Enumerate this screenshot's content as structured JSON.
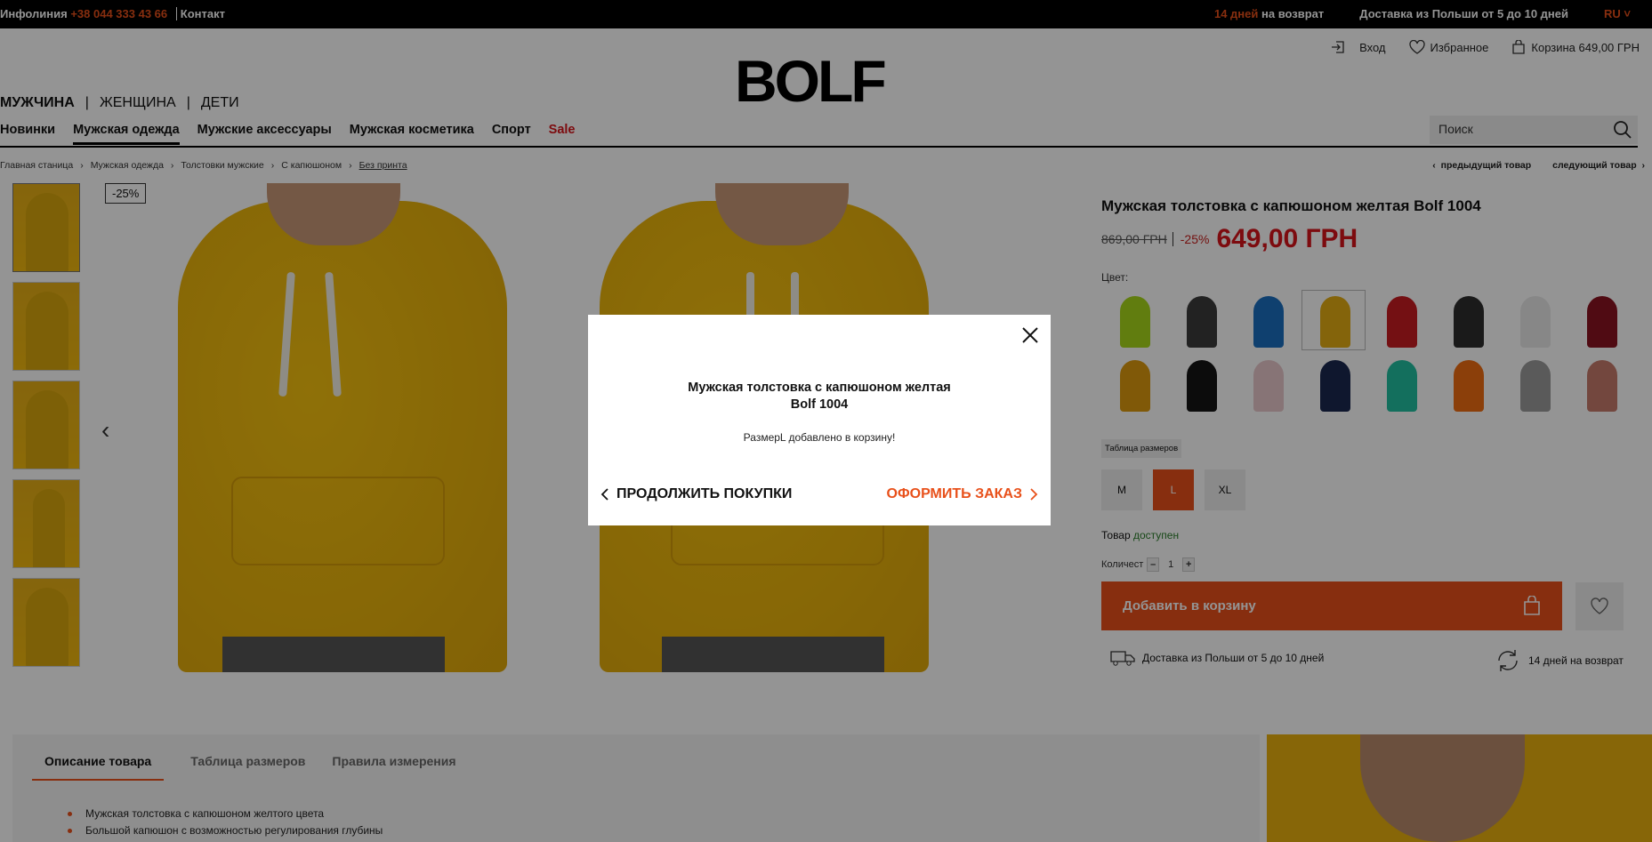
{
  "topbar": {
    "infoline_label": "Инфолиния",
    "phone": "+38 044 333 43 66",
    "contact": "Контакт",
    "return_days": "14 дней",
    "return_text": " на возврат",
    "delivery": "Доставка из Польши от 5 до 10 дней",
    "lang": "RU"
  },
  "header": {
    "login": "Вход",
    "favorites": "Избранное",
    "cart": "Корзина 649,00 ГРН",
    "logo_text": "BOLF"
  },
  "gender_nav": [
    "МУЖЧИНА",
    "|",
    "ЖЕНЩИНА",
    "|",
    "ДЕТИ"
  ],
  "main_nav": [
    "Новинки",
    "Мужская одежда",
    "Мужские аксессуары",
    "Мужская косметика",
    "Спорт",
    "Sale"
  ],
  "search": {
    "placeholder": "Поиск"
  },
  "breadcrumbs": [
    "Главная станица",
    "Мужская одежда",
    "Толстовки мужские",
    "С капюшоном",
    "Без принта"
  ],
  "pager": {
    "prev": "предыдущий товар",
    "next": "следующий товар"
  },
  "gallery": {
    "discount": "-25%"
  },
  "product": {
    "title": "Мужская толстовка с капюшоном желтая Bolf 1004",
    "old_price": "869,00 ГРН",
    "discount": "-25%",
    "price": "649,00 ГРН",
    "color_label": "Цвет:",
    "colors": [
      "#a8d81a",
      "#3b3b3b",
      "#1a6fc0",
      "#e4ad13",
      "#c91d22",
      "#2d2d2d",
      "#e9e9e9",
      "#8a1422",
      "#dc9a0e",
      "#151515",
      "#e8c8cc",
      "#1b2850",
      "#22bfa0",
      "#ef6d12",
      "#9b9b9b",
      "#c67b6c"
    ],
    "selected_color": "#e4ad13",
    "size_table": "Таблица размеров",
    "sizes": [
      "M",
      "L",
      "XL"
    ],
    "selected_size": "L",
    "avail_prefix": "Товар",
    "avail_status": "доступен",
    "qty_label": "Количест",
    "qty_minus": "–",
    "qty_value": "1",
    "qty_plus": "+",
    "add_to_cart": "Добавить в корзину",
    "delivery": "Доставка из Польши от 5 до 10 дней",
    "returns": "14 дней на возврат"
  },
  "description": {
    "tabs": [
      "Описание товара",
      "Таблица размеров",
      "Правила измерения"
    ],
    "bullets": [
      "Мужская толстовка с капюшоном желтого цвета",
      "Большой капюшон с возможностью регулирования глубины"
    ]
  },
  "modal": {
    "title_line1": "Мужская толстовка с капюшоном желтая",
    "title_line2": "Bolf 1004",
    "message": "РазмерL добавлено в корзину!",
    "continue": "ПРОДОЛЖИТЬ ПОКУПКИ",
    "checkout": "ОФОРМИТЬ ЗАКАЗ"
  }
}
